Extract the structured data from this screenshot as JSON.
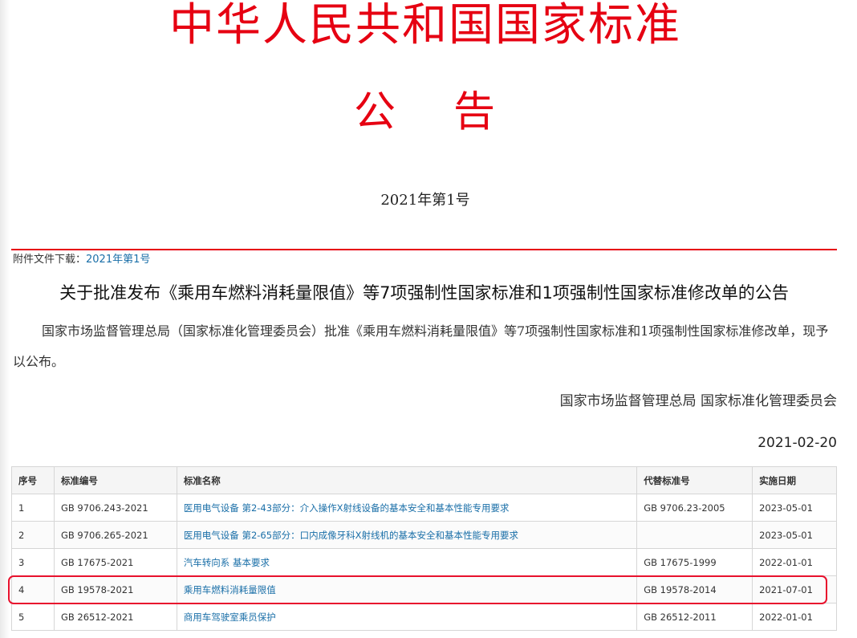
{
  "header": {
    "main_title": "中华人民共和国国家标准",
    "sub_title_left": "公",
    "sub_title_right": "告",
    "issue_number": "2021年第1号"
  },
  "attachment": {
    "label": "附件文件下载：",
    "link_text": "2021年第1号"
  },
  "notice": {
    "heading": "关于批准发布《乘用车燃料消耗量限值》等7项强制性国家标准和1项强制性国家标准修改单的公告",
    "body": "国家市场监督管理总局（国家标准化管理委员会）批准《乘用车燃料消耗量限值》等7项强制性国家标准和1项强制性国家标准修改单，现予以公布。",
    "signature": "国家市场监督管理总局 国家标准化管理委员会",
    "date": "2021-02-20"
  },
  "table": {
    "headers": {
      "no": "序号",
      "code": "标准编号",
      "name": "标准名称",
      "replaces": "代替标准号",
      "effective": "实施日期"
    },
    "rows": [
      {
        "no": "1",
        "code": "GB 9706.243-2021",
        "name": "医用电气设备 第2-43部分：介入操作X射线设备的基本安全和基本性能专用要求",
        "replaces": "GB 9706.23-2005",
        "effective": "2023-05-01"
      },
      {
        "no": "2",
        "code": "GB 9706.265-2021",
        "name": "医用电气设备 第2-65部分：口内成像牙科X射线机的基本安全和基本性能专用要求",
        "replaces": "",
        "effective": "2023-05-01"
      },
      {
        "no": "3",
        "code": "GB 17675-2021",
        "name": "汽车转向系 基本要求",
        "replaces": "GB 17675-1999",
        "effective": "2022-01-01"
      },
      {
        "no": "4",
        "code": "GB 19578-2021",
        "name": "乘用车燃料消耗量限值",
        "replaces": "GB 19578-2014",
        "effective": "2021-07-01"
      },
      {
        "no": "5",
        "code": "GB 26512-2021",
        "name": "商用车驾驶室乘员保护",
        "replaces": "GB 26512-2011",
        "effective": "2022-01-01"
      }
    ],
    "highlighted_row": 4
  },
  "colors": {
    "title_red": "#e60012",
    "link_blue": "#1a6fa8",
    "highlight_red": "#e8112d"
  }
}
